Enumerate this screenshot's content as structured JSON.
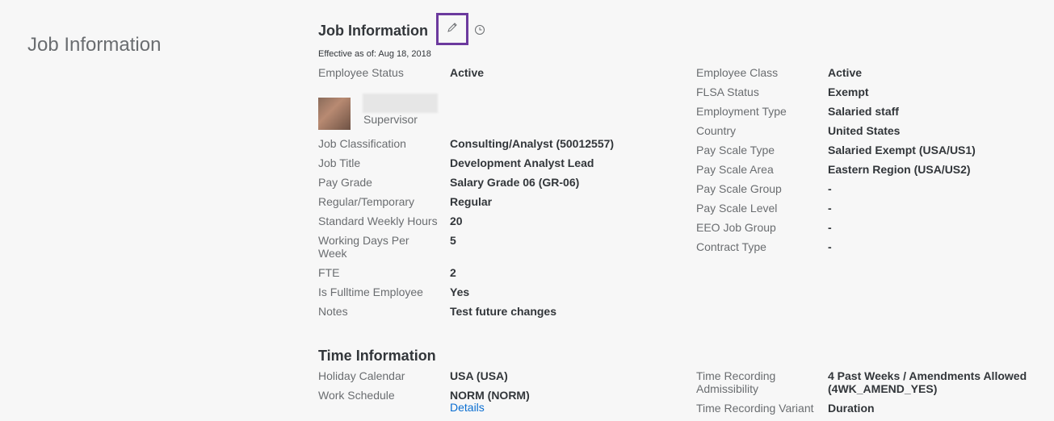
{
  "page": {
    "heading": "Job Information"
  },
  "job_info": {
    "title": "Job Information",
    "effective": "Effective as of: Aug 18, 2018",
    "edit_icon": "pencil-icon",
    "history_icon": "clock-icon",
    "supervisor_label": "Supervisor",
    "left": [
      {
        "label": "Employee Status",
        "value": "Active"
      },
      {
        "label": "Job Classification",
        "value": "Consulting/Analyst (50012557)"
      },
      {
        "label": "Job Title",
        "value": "Development Analyst Lead"
      },
      {
        "label": "Pay Grade",
        "value": "Salary Grade 06 (GR-06)"
      },
      {
        "label": "Regular/Temporary",
        "value": "Regular"
      },
      {
        "label": "Standard Weekly Hours",
        "value": "20"
      },
      {
        "label": "Working Days Per",
        "label2": "Week",
        "value": "5"
      },
      {
        "label": "FTE",
        "value": "2"
      },
      {
        "label": "Is Fulltime Employee",
        "value": "Yes"
      },
      {
        "label": "Notes",
        "value": "Test future changes"
      }
    ],
    "right": [
      {
        "label": "Employee Class",
        "value": "Active"
      },
      {
        "label": "FLSA Status",
        "value": "Exempt"
      },
      {
        "label": "Employment Type",
        "value": "Salaried staff"
      },
      {
        "label": "Country",
        "value": "United States"
      },
      {
        "label": "Pay Scale Type",
        "value": "Salaried Exempt (USA/US1)"
      },
      {
        "label": "Pay Scale Area",
        "value": "Eastern Region (USA/US2)"
      },
      {
        "label": "Pay Scale Group",
        "value": "-"
      },
      {
        "label": "Pay Scale Level",
        "value": "-"
      },
      {
        "label": "EEO Job Group",
        "value": "-"
      },
      {
        "label": "Contract Type",
        "value": "-"
      }
    ]
  },
  "time_info": {
    "title": "Time Information",
    "left": [
      {
        "label": "Holiday Calendar",
        "value": "USA (USA)"
      },
      {
        "label": "Work Schedule",
        "value": "NORM (NORM)",
        "link": "Details"
      }
    ],
    "right": [
      {
        "label": "Time Recording",
        "label2": "Admissibility",
        "value": "4 Past Weeks / Amendments Allowed",
        "value2": "(4WK_AMEND_YES)"
      },
      {
        "label": "Time Recording Variant",
        "value": "Duration"
      }
    ]
  }
}
